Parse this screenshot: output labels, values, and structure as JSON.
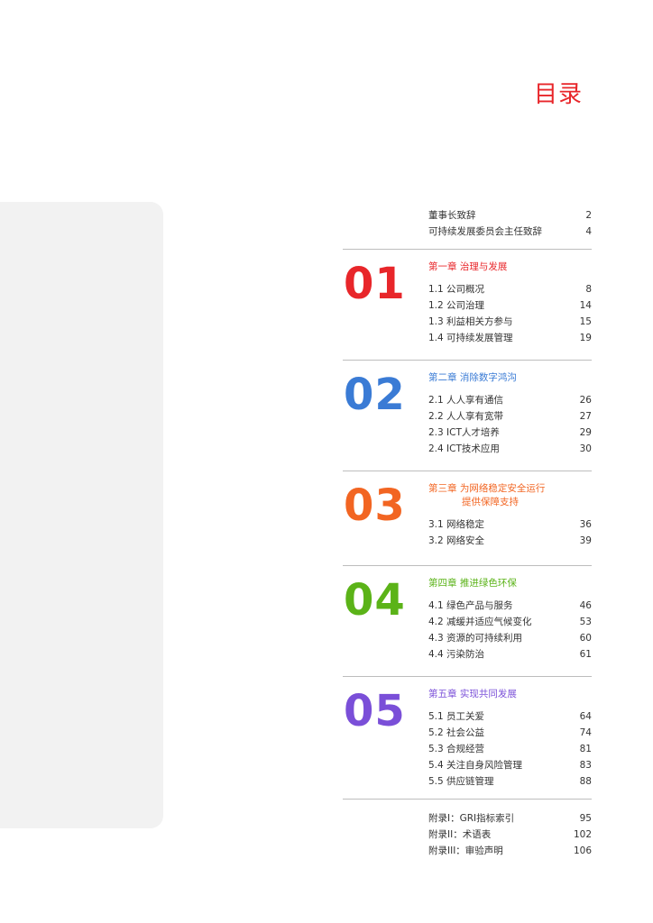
{
  "title": "目录",
  "intro": [
    {
      "label": "董事长致辞",
      "page": "2"
    },
    {
      "label": "可持续发展委员会主任致辞",
      "page": "4"
    }
  ],
  "chapters": [
    {
      "number": "01",
      "color": "#e8262a",
      "title": "第一章 治理与发展",
      "title_line2": "",
      "items": [
        {
          "label": "1.1 公司概况",
          "page": "8"
        },
        {
          "label": "1.2 公司治理",
          "page": "14"
        },
        {
          "label": "1.3 利益相关方参与",
          "page": "15"
        },
        {
          "label": "1.4 可持续发展管理",
          "page": "19"
        }
      ]
    },
    {
      "number": "02",
      "color": "#3a7bd5",
      "title": "第二章 消除数字鸿沟",
      "title_line2": "",
      "items": [
        {
          "label": "2.1 人人享有通信",
          "page": "26"
        },
        {
          "label": "2.2 人人享有宽带",
          "page": "27"
        },
        {
          "label": "2.3 ICT人才培养",
          "page": "29"
        },
        {
          "label": "2.4 ICT技术应用",
          "page": "30"
        }
      ]
    },
    {
      "number": "03",
      "color": "#f26522",
      "title": "第三章 为网络稳定安全运行",
      "title_line2": "提供保障支持",
      "items": [
        {
          "label": "3.1 网络稳定",
          "page": "36"
        },
        {
          "label": "3.2 网络安全",
          "page": "39"
        }
      ]
    },
    {
      "number": "04",
      "color": "#5bb318",
      "title": "第四章 推进绿色环保",
      "title_line2": "",
      "items": [
        {
          "label": "4.1 绿色产品与服务",
          "page": "46"
        },
        {
          "label": "4.2 减缓并适应气候变化",
          "page": "53"
        },
        {
          "label": "4.3 资源的可持续利用",
          "page": "60"
        },
        {
          "label": "4.4 污染防治",
          "page": "61"
        }
      ]
    },
    {
      "number": "05",
      "color": "#7a4fd8",
      "title": "第五章 实现共同发展",
      "title_line2": "",
      "items": [
        {
          "label": "5.1 员工关爱",
          "page": "64"
        },
        {
          "label": "5.2 社会公益",
          "page": "74"
        },
        {
          "label": "5.3 合规经营",
          "page": "81"
        },
        {
          "label": "5.4 关注自身风险管理",
          "page": "83"
        },
        {
          "label": "5.5 供应链管理",
          "page": "88"
        }
      ]
    }
  ],
  "appendix": [
    {
      "label": "附录I：GRI指标索引",
      "page": "95"
    },
    {
      "label": "附录II：术语表",
      "page": "102"
    },
    {
      "label": "附录III：审验声明",
      "page": "106"
    }
  ]
}
